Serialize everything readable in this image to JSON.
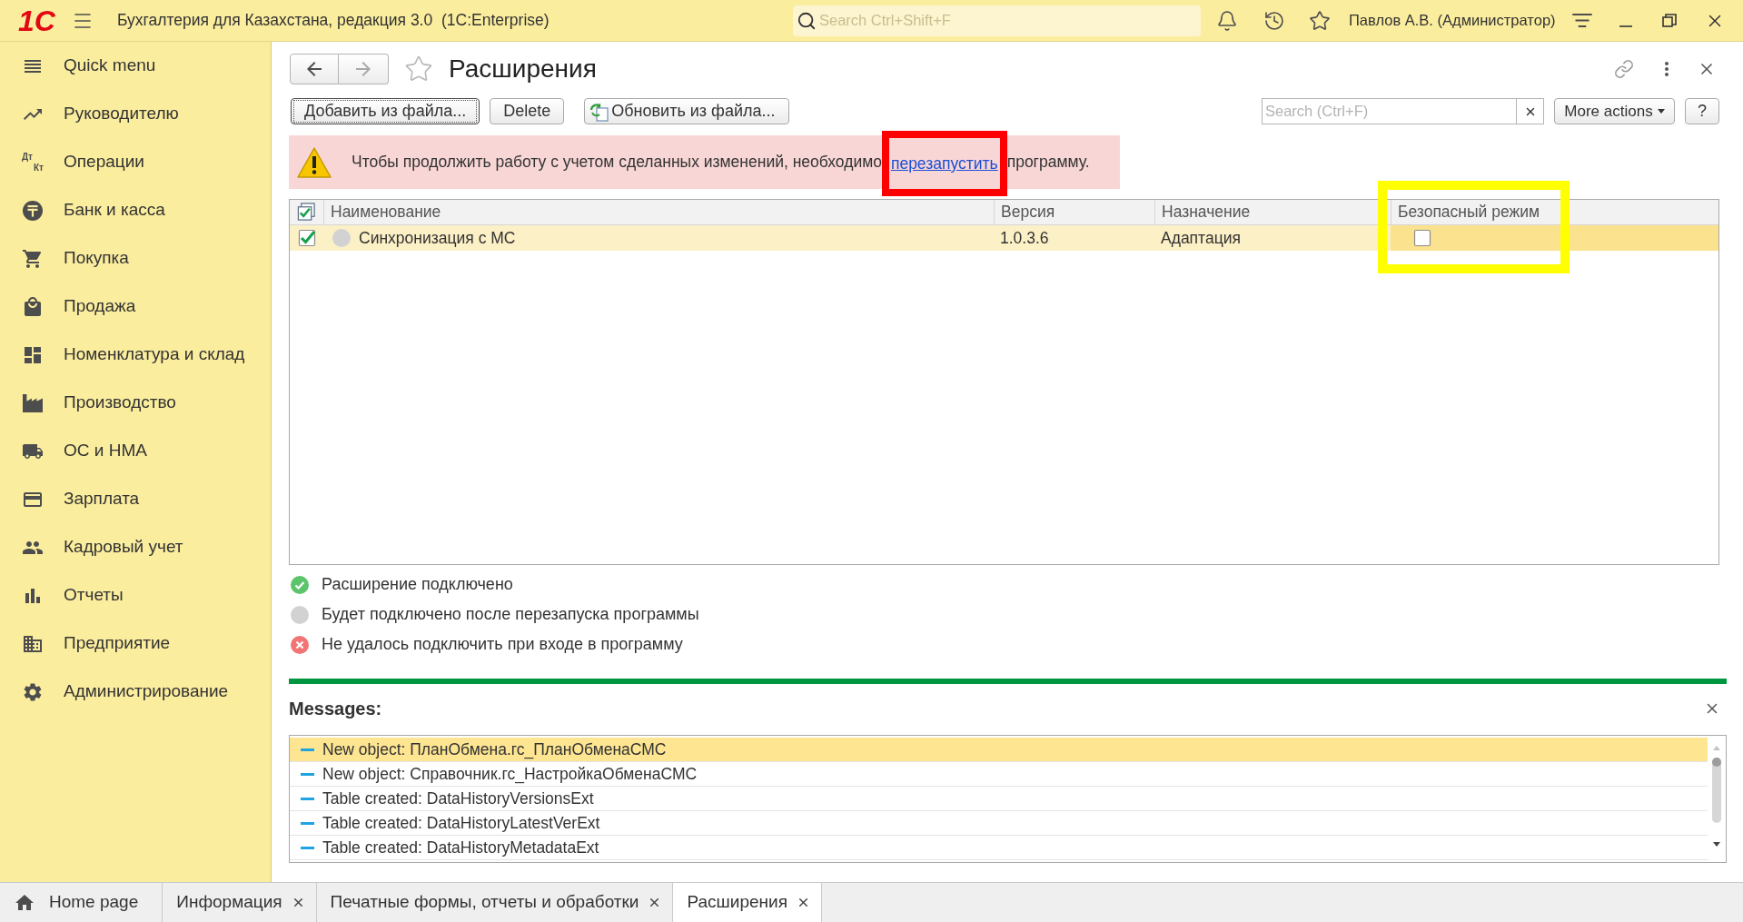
{
  "window": {
    "logo": "1С",
    "title": "Бухгалтерия для Казахстана, редакция 3.0  (1C:Enterprise)",
    "search": {
      "placeholder": "Search Ctrl+Shift+F"
    },
    "user": "Павлов А.В. (Администратор)"
  },
  "sidebar": {
    "items": [
      {
        "label": "Quick menu"
      },
      {
        "label": "Руководителю"
      },
      {
        "label": "Операции",
        "icon_text": [
          "Дт",
          "Кт"
        ]
      },
      {
        "label": "Банк и касса"
      },
      {
        "label": "Покупка"
      },
      {
        "label": "Продажа"
      },
      {
        "label": "Номенклатура и склад"
      },
      {
        "label": "Производство"
      },
      {
        "label": "ОС и НМА"
      },
      {
        "label": "Зарплата"
      },
      {
        "label": "Кадровый учет"
      },
      {
        "label": "Отчеты"
      },
      {
        "label": "Предприятие"
      },
      {
        "label": "Администрирование"
      }
    ]
  },
  "form": {
    "title": "Расширения",
    "back_disabled": false,
    "forward_disabled": true,
    "toolbar": {
      "buttons": [
        {
          "label": "Добавить из файла...",
          "kind": "text",
          "focused": true
        },
        {
          "label": "Delete",
          "kind": "text",
          "focused": false
        },
        {
          "label": "Обновить из файла...",
          "kind": "icon_text",
          "focused": false
        }
      ],
      "search": {
        "placeholder": "Search (Ctrl+F)"
      },
      "more_actions": "More actions",
      "help": "?"
    },
    "banner": {
      "text": "Чтобы продолжить работу с учетом сделанных изменений, необходимо",
      "link": "перезапустить",
      "text_after": "программу.",
      "link_highlighted": true
    },
    "table": {
      "columns": [
        {
          "label": "Наименование",
          "highlighted": false
        },
        {
          "label": "Версия",
          "highlighted": false
        },
        {
          "label": "Назначение",
          "highlighted": false
        },
        {
          "label": "Безопасный режим",
          "highlighted": true
        }
      ],
      "rows": [
        {
          "enabled": true,
          "kind": "pending",
          "name": "Синхронизация с МС",
          "version": "1.0.3.6",
          "purpose": "Адаптация",
          "safe_mode": false,
          "selected": true
        }
      ]
    },
    "legend": [
      {
        "kind": "connected",
        "text": "Расширение подключено"
      },
      {
        "kind": "pending",
        "text": "Будет подключено после перезапуска программы"
      },
      {
        "kind": "failed",
        "text": "Не удалось подключить при входе в программу"
      }
    ]
  },
  "messages": {
    "title": "Messages:",
    "items": [
      {
        "text": "New object: ПланОбмена.гс_ПланОбменаСМС",
        "selected": true
      },
      {
        "text": "New object: Справочник.гс_НастройкаОбменаСМС",
        "selected": false
      },
      {
        "text": "Table created: DataHistoryVersionsExt",
        "selected": false
      },
      {
        "text": "Table created: DataHistoryLatestVerExt",
        "selected": false
      },
      {
        "text": "Table created: DataHistoryMetadataExt",
        "selected": false
      }
    ]
  },
  "tabs": [
    {
      "kind": "home",
      "label": "Home page",
      "selected": false
    },
    {
      "kind": "form",
      "label": "Информация",
      "selected": false
    },
    {
      "kind": "form",
      "label": "Печатные формы, отчеты и обработки",
      "selected": false
    },
    {
      "kind": "form",
      "label": "Расширения",
      "selected": true
    }
  ]
}
